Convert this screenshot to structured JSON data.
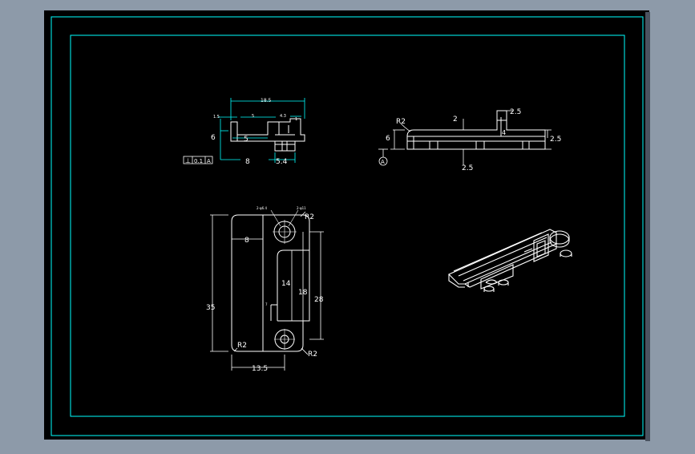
{
  "colors": {
    "window_bg": "#8d9aa9",
    "sheet_bg": "#000000",
    "frame": "#00ffff",
    "geometry": "#ffffff",
    "dimension": "#00ffff"
  },
  "views": {
    "top_left": {
      "dims": [
        "18.5",
        "1.5",
        "5",
        "6",
        "5",
        "8",
        "5.4"
      ],
      "small": [
        "4.3",
        "1"
      ],
      "gdt": [
        "⊥",
        "0.1",
        "A"
      ]
    },
    "top_right": {
      "dims": [
        "R2",
        "2",
        "6",
        "2.5",
        "4",
        "2.5",
        "2.5"
      ],
      "datum": "A"
    },
    "front": {
      "dims": [
        "R2",
        "8",
        "35",
        "14",
        "18",
        "28",
        "R2",
        "R2",
        "13.5"
      ],
      "holes": [
        "2-φ6.4",
        "2-φ11"
      ],
      "small": [
        "7"
      ]
    }
  }
}
